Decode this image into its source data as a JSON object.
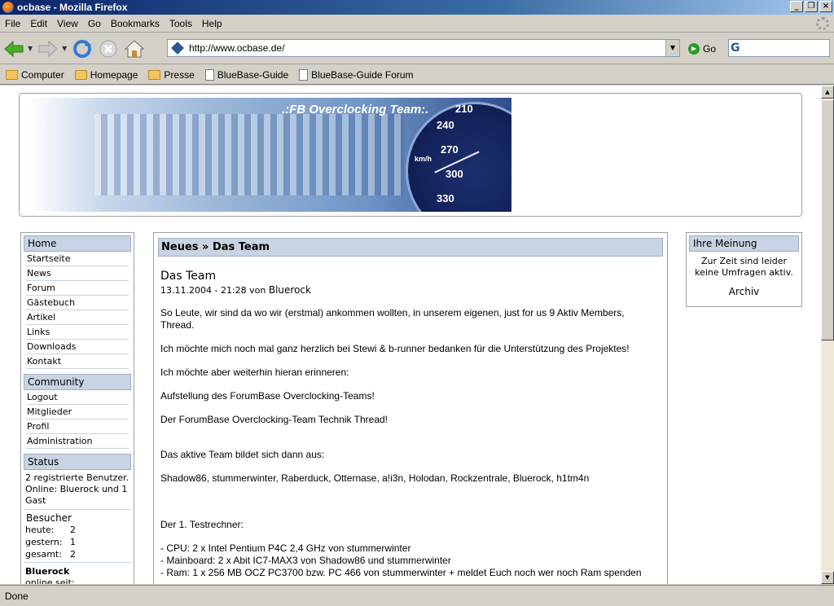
{
  "window": {
    "title": "ocbase - Mozilla Firefox"
  },
  "menu": [
    "File",
    "Edit",
    "View",
    "Go",
    "Bookmarks",
    "Tools",
    "Help"
  ],
  "nav": {
    "url": "http://www.ocbase.de/",
    "go_label": "Go"
  },
  "bookmarks": [
    "Computer",
    "Homepage",
    "Presse",
    "BlueBase-Guide",
    "BlueBase-Guide Forum"
  ],
  "status": "Done",
  "banner": {
    "title": ".:FB Overclocking Team:.",
    "gauge_labels": [
      "210",
      "240",
      "270",
      "300",
      "330",
      "km/h"
    ]
  },
  "left": {
    "home_title": "Home",
    "home_links": [
      "Startseite",
      "News",
      "Forum",
      "Gästebuch",
      "Artikel",
      "Links",
      "Downloads",
      "Kontakt"
    ],
    "community_title": "Community",
    "community_links": [
      "Logout",
      "Mitglieder",
      "Profil",
      "Administration"
    ],
    "status_title": "Status",
    "status_text": "2 registrierte Benutzer. Online: Bluerock und 1 Gast",
    "visitors_title": "Besucher",
    "visitors": [
      {
        "label": "heute:",
        "value": "2"
      },
      {
        "label": "gestern:",
        "value": "1"
      },
      {
        "label": "gesamt:",
        "value": "2"
      }
    ],
    "user_name": "Bluerock",
    "user_online": "online seit:"
  },
  "main": {
    "breadcrumb": "Neues » Das Team",
    "title": "Das Team",
    "date": "13.11.2004 - 21:28 von",
    "author": "Bluerock",
    "paragraphs": [
      "So Leute, wir sind da wo wir (erstmal) ankommen wollten, in unserem eigenen, just for us 9 Aktiv Members, Thread.",
      "Ich möchte mich noch mal ganz herzlich bei Stewi & b-runner bedanken für die Unterstützung des Projektes!",
      "Ich möchte aber weiterhin hieran erinneren:",
      "Aufstellung des ForumBase Overclocking-Teams!",
      "Der ForumBase Overclocking-Team Technik Thread!",
      "Das aktive Team bildet sich dann aus:",
      "Shadow86, stummerwinter, Raberduck, Otternase, a!i3n, Holodan, Rockzentrale, Bluerock, h1tm4n",
      "Der 1. Testrechner:"
    ],
    "specs": [
      "- CPU: 2 x Intel Pentium P4C 2,4 GHz von stummerwinter",
      "- Mainboard: 2 x Abit IC7-MAX3 von Shadow86 und stummerwinter",
      "- Ram: 1 x 256 MB OCZ PC3700 bzw. PC 466 von stummerwinter + meldet Euch noch wer noch Ram spenden"
    ]
  },
  "right": {
    "title": "Ihre Meinung",
    "text": "Zur Zeit sind leider keine Umfragen aktiv.",
    "archive": "Archiv"
  }
}
